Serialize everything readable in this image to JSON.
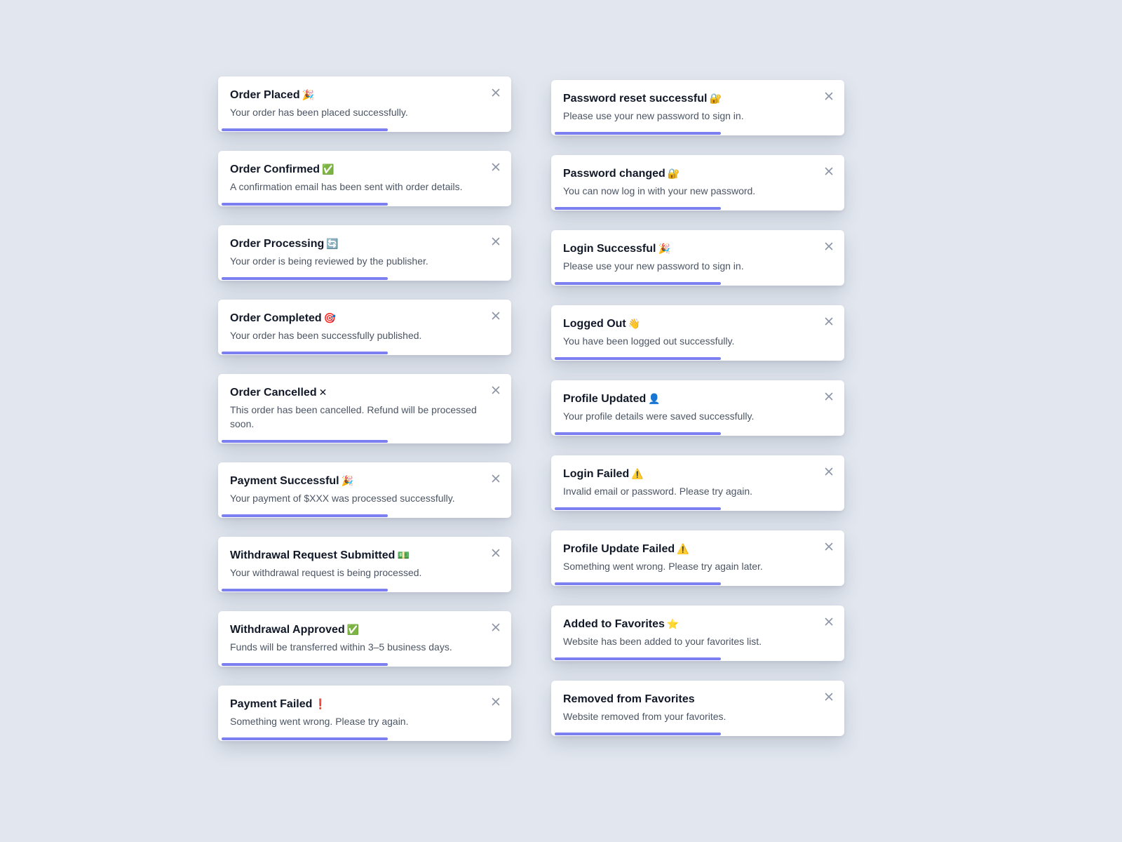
{
  "theme": {
    "background": "#e2e7ef",
    "card": "#ffffff",
    "progress": "#7c7ff0",
    "close_icon": "#8a94a6",
    "title_text": "#111827",
    "message_text": "#4b5563"
  },
  "close_icon_name": "close-icon",
  "left_toasts": [
    {
      "id": "order-placed",
      "title": "Order Placed",
      "emoji": "🎉",
      "emoji_color": "#e58a2b",
      "message": "Your order has been placed successfully.",
      "progress": 0.58
    },
    {
      "id": "order-confirmed",
      "title": "Order Confirmed",
      "emoji": "✅",
      "emoji_color": "#22a34a",
      "message": "A confirmation email has been sent with order details.",
      "progress": 0.58
    },
    {
      "id": "order-processing",
      "title": "Order Processing",
      "emoji": "🔄",
      "emoji_color": "#3b82f6",
      "message": "Your order is being reviewed by the publisher.",
      "progress": 0.58
    },
    {
      "id": "order-completed",
      "title": "Order Completed",
      "emoji": "🎯",
      "emoji_color": "#dc2626",
      "message": "Your order has been successfully published.",
      "progress": 0.58
    },
    {
      "id": "order-cancelled",
      "title": "Order Cancelled",
      "emoji": "✕",
      "emoji_color": "#111827",
      "message": "This order has been cancelled. Refund will be processed soon.",
      "progress": 0.58
    },
    {
      "id": "payment-successful",
      "title": "Payment Successful",
      "emoji": "🎉",
      "emoji_color": "#e58a2b",
      "message": "Your payment of $XXX was processed successfully.",
      "progress": 0.58
    },
    {
      "id": "withdrawal-request-submitted",
      "title": "Withdrawal Request Submitted",
      "emoji": "💵",
      "emoji_color": "#65a30d",
      "message": "Your withdrawal request is being processed.",
      "progress": 0.58
    },
    {
      "id": "withdrawal-approved",
      "title": "Withdrawal Approved",
      "emoji": "✅",
      "emoji_color": "#22a34a",
      "message": "Funds will be transferred within 3–5 business days.",
      "progress": 0.58
    },
    {
      "id": "payment-failed",
      "title": "Payment Failed",
      "emoji": "❗",
      "emoji_color": "#dc2626",
      "message": "Something went wrong. Please try again.",
      "progress": 0.58
    }
  ],
  "right_toasts": [
    {
      "id": "password-reset-successful",
      "title": "Password reset successful",
      "emoji": "🔐",
      "emoji_color": "#c58b1a",
      "message": "Please use your new password to sign in.",
      "progress": 0.58
    },
    {
      "id": "password-changed",
      "title": "Password changed",
      "emoji": "🔐",
      "emoji_color": "#c58b1a",
      "message": "You can now log in with your new password.",
      "progress": 0.58
    },
    {
      "id": "login-successful",
      "title": "Login Successful",
      "emoji": "🎉",
      "emoji_color": "#e58a2b",
      "message": "Please use your new password to sign in.",
      "progress": 0.58
    },
    {
      "id": "logged-out",
      "title": "Logged Out",
      "emoji": "👋",
      "emoji_color": "#f2b63c",
      "message": "You have been logged out successfully.",
      "progress": 0.58
    },
    {
      "id": "profile-updated",
      "title": "Profile Updated",
      "emoji": "👤",
      "emoji_color": "#4b6b8a",
      "message": "Your profile details were saved successfully.",
      "progress": 0.58
    },
    {
      "id": "login-failed",
      "title": "Login Failed",
      "emoji": "⚠️",
      "emoji_color": "#e6a700",
      "message": "Invalid email or password. Please try again.",
      "progress": 0.58
    },
    {
      "id": "profile-update-failed",
      "title": "Profile Update Failed",
      "emoji": "⚠️",
      "emoji_color": "#e6a700",
      "message": "Something went wrong. Please try again later.",
      "progress": 0.58
    },
    {
      "id": "added-to-favorites",
      "title": "Added to Favorites",
      "emoji": "⭐",
      "emoji_color": "#f5b301",
      "message": "Website has been added to your favorites list.",
      "progress": 0.58
    },
    {
      "id": "removed-from-favorites",
      "title": "Removed from Favorites",
      "emoji": "",
      "emoji_color": "#111827",
      "message": "Website removed from your favorites.",
      "progress": 0.58
    }
  ]
}
